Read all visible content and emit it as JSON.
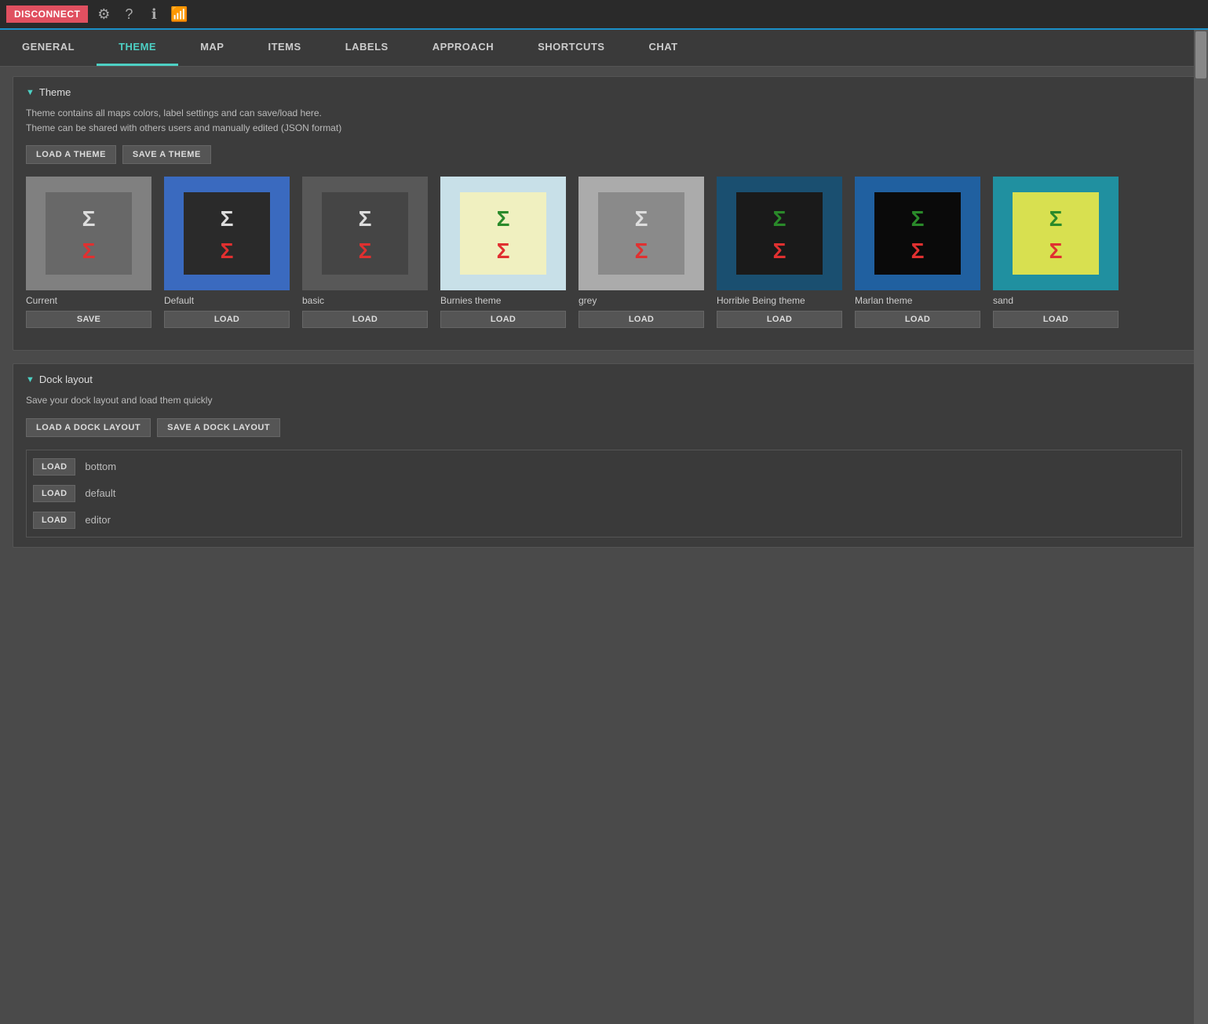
{
  "topbar": {
    "disconnect_label": "DISCONNECT",
    "icons": [
      "gear-icon",
      "question-icon",
      "info-icon",
      "signal-icon"
    ]
  },
  "nav": {
    "tabs": [
      {
        "id": "general",
        "label": "GENERAL",
        "active": false
      },
      {
        "id": "theme",
        "label": "THEME",
        "active": true
      },
      {
        "id": "map",
        "label": "MAP",
        "active": false
      },
      {
        "id": "items",
        "label": "ITEMS",
        "active": false
      },
      {
        "id": "labels",
        "label": "LABELS",
        "active": false
      },
      {
        "id": "approach",
        "label": "APPROACH",
        "active": false
      },
      {
        "id": "shortcuts",
        "label": "SHORTCUTS",
        "active": false
      },
      {
        "id": "chat",
        "label": "CHAT",
        "active": false
      }
    ]
  },
  "theme_section": {
    "header": "Theme",
    "desc_line1": "Theme contains all maps colors, label settings and can save/load here.",
    "desc_line2": "Theme can be shared with others users and manually edited (JSON format)",
    "load_btn": "LOAD A THEME",
    "save_btn": "SAVE A THEME",
    "themes": [
      {
        "id": "current",
        "label": "Current",
        "border_color": "#888",
        "bg_outer": "#888",
        "bg_inner": "#707070",
        "sigma_top_color": "#ddd",
        "sigma_bottom_color": "#e03030",
        "button": "SAVE"
      },
      {
        "id": "default",
        "label": "Default",
        "border_color": "#3a6abf",
        "bg_outer": "#3a6abf",
        "bg_inner": "#333",
        "sigma_top_color": "#ddd",
        "sigma_bottom_color": "#e03030",
        "button": "LOAD"
      },
      {
        "id": "basic",
        "label": "basic",
        "border_color": "#555",
        "bg_outer": "#555",
        "bg_inner": "#444",
        "sigma_top_color": "#ddd",
        "sigma_bottom_color": "#e03030",
        "button": "LOAD"
      },
      {
        "id": "burnies",
        "label": "Burnies theme",
        "border_color": "#b8d8e8",
        "bg_outer": "#cce8d0",
        "bg_inner": "#f0f0c0",
        "sigma_top_color": "#2a8a2a",
        "sigma_bottom_color": "#e03030",
        "button": "LOAD"
      },
      {
        "id": "grey",
        "label": "grey",
        "border_color": "#aaa",
        "bg_outer": "#aaa",
        "bg_inner": "#888",
        "sigma_top_color": "#ddd",
        "sigma_bottom_color": "#e03030",
        "button": "LOAD"
      },
      {
        "id": "horrible",
        "label": "Horrible Being theme",
        "border_color": "#1a5070",
        "bg_outer": "#1a5070",
        "bg_inner": "#222",
        "sigma_top_color": "#2a8a2a",
        "sigma_bottom_color": "#e03030",
        "button": "LOAD"
      },
      {
        "id": "marlan",
        "label": "Marlan theme",
        "border_color": "#2060a0",
        "bg_outer": "#2060a0",
        "bg_inner": "#111",
        "sigma_top_color": "#2a8a2a",
        "sigma_bottom_color": "#e03030",
        "button": "LOAD"
      },
      {
        "id": "sand",
        "label": "sand",
        "border_color": "#2090a0",
        "bg_outer": "#2090a0",
        "bg_inner": "#d8e050",
        "sigma_top_color": "#2a8a2a",
        "sigma_bottom_color": "#e03030",
        "button": "LOAD"
      }
    ]
  },
  "dock_section": {
    "header": "Dock layout",
    "desc": "Save your dock layout and load them quickly",
    "load_btn": "LOAD A DOCK LAYOUT",
    "save_btn": "SAVE A DOCK LAYOUT",
    "layouts": [
      {
        "id": "bottom",
        "label": "bottom",
        "button": "LOAD"
      },
      {
        "id": "default",
        "label": "default",
        "button": "LOAD"
      },
      {
        "id": "editor",
        "label": "editor",
        "button": "LOAD"
      }
    ]
  }
}
